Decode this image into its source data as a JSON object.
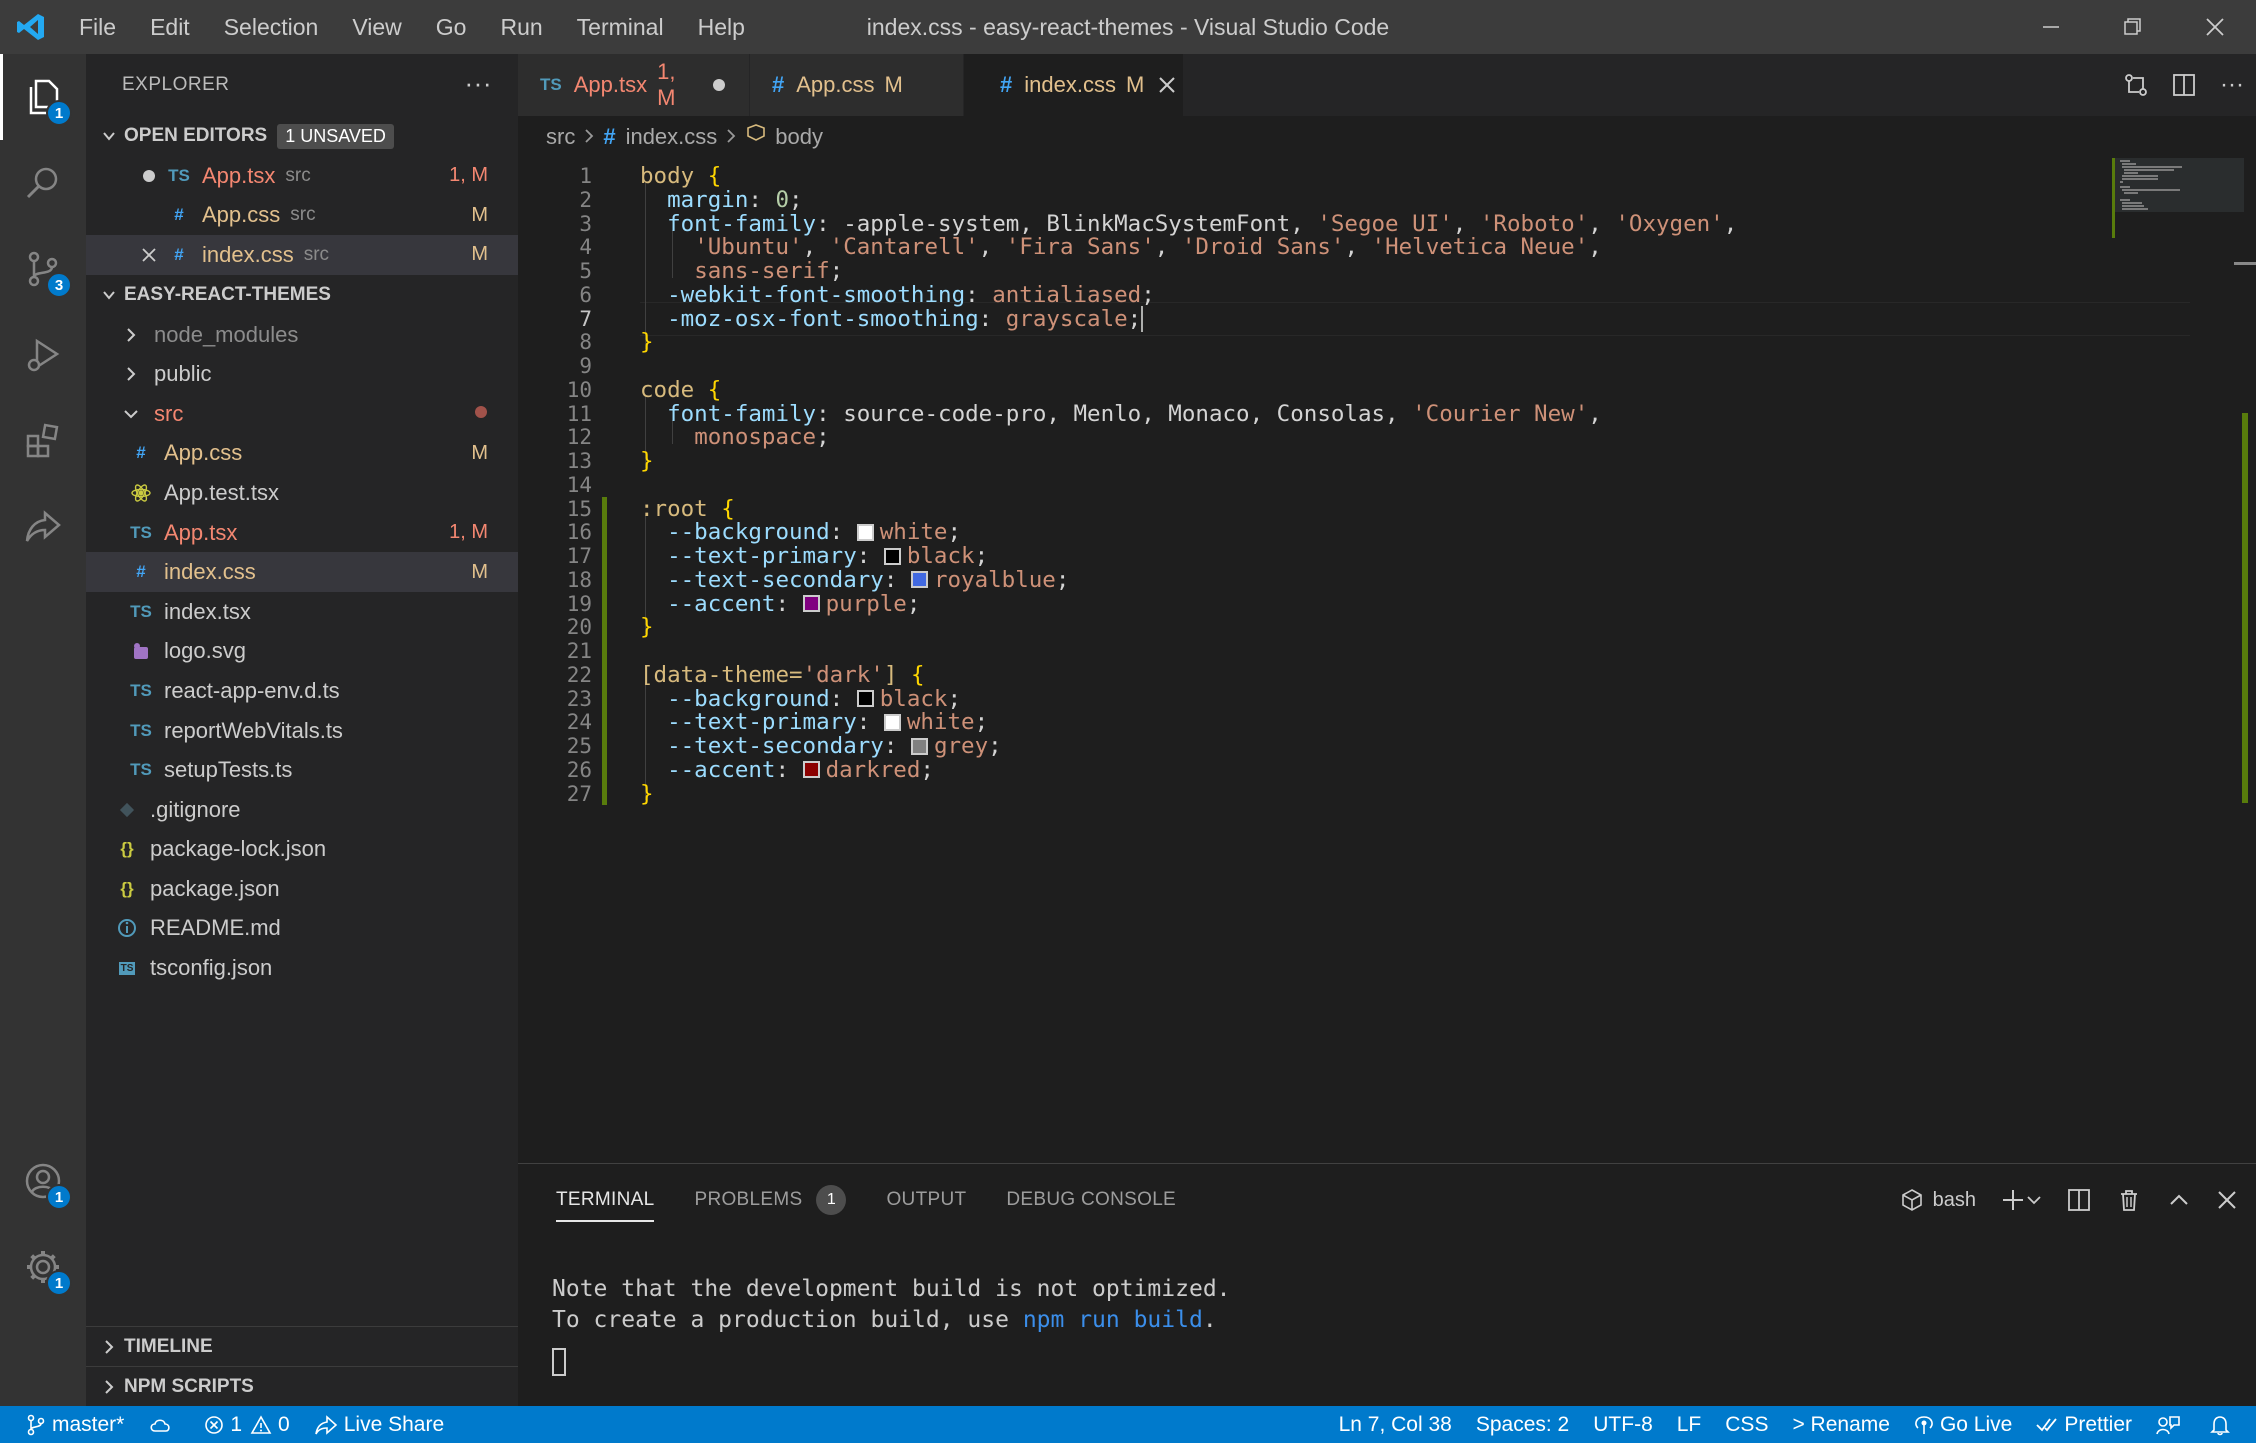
{
  "window": {
    "title": "index.css - easy-react-themes - Visual Studio Code",
    "menu": [
      "File",
      "Edit",
      "Selection",
      "View",
      "Go",
      "Run",
      "Terminal",
      "Help"
    ]
  },
  "activity_bar": {
    "explorer_badge": "1",
    "source_control_badge": "3",
    "accounts_badge": "1",
    "settings_badge": "1"
  },
  "sidebar": {
    "title": "EXPLORER",
    "open_editors": {
      "label": "OPEN EDITORS",
      "badge": "1 UNSAVED",
      "items": [
        {
          "icon": "TS",
          "name": "App.tsx",
          "desc": "src",
          "status": "1, M"
        },
        {
          "icon": "#",
          "name": "App.css",
          "desc": "src",
          "status": "M"
        },
        {
          "icon": "#",
          "name": "index.css",
          "desc": "src",
          "status": "M"
        }
      ]
    },
    "project": {
      "label": "EASY-REACT-THEMES",
      "items": [
        {
          "name": "node_modules",
          "status": ""
        },
        {
          "name": "public",
          "status": ""
        },
        {
          "name": "src",
          "status": ""
        },
        {
          "icon": "#",
          "name": "App.css",
          "status": "M"
        },
        {
          "name": "App.test.tsx",
          "status": ""
        },
        {
          "icon": "TS",
          "name": "App.tsx",
          "status": "1, M"
        },
        {
          "icon": "#",
          "name": "index.css",
          "status": "M"
        },
        {
          "icon": "TS",
          "name": "index.tsx",
          "status": ""
        },
        {
          "name": "logo.svg",
          "status": ""
        },
        {
          "icon": "TS",
          "name": "react-app-env.d.ts",
          "status": ""
        },
        {
          "icon": "TS",
          "name": "reportWebVitals.ts",
          "status": ""
        },
        {
          "icon": "TS",
          "name": "setupTests.ts",
          "status": ""
        },
        {
          "name": ".gitignore",
          "status": ""
        },
        {
          "icon": "{}",
          "name": "package-lock.json",
          "status": ""
        },
        {
          "icon": "{}",
          "name": "package.json",
          "status": ""
        },
        {
          "name": "README.md",
          "status": ""
        },
        {
          "icon": "TS",
          "name": "tsconfig.json",
          "status": ""
        }
      ]
    },
    "timeline_label": "TIMELINE",
    "npm_scripts_label": "NPM SCRIPTS"
  },
  "tabs": [
    {
      "icon": "TS",
      "name": "App.tsx",
      "status": "1, M"
    },
    {
      "icon": "#",
      "name": "App.css",
      "status": "M"
    },
    {
      "icon": "#",
      "name": "index.css",
      "status": "M"
    }
  ],
  "breadcrumbs": {
    "folder": "src",
    "icon": "#",
    "file": "index.css",
    "symbol": "body"
  },
  "code_lines": [
    [
      [
        "t-sel",
        "body"
      ],
      [
        "t-plain",
        " "
      ],
      [
        "t-brace",
        "{"
      ]
    ],
    [
      [
        "t-plain",
        "  "
      ],
      [
        "t-prop",
        "margin"
      ],
      [
        "t-plain",
        ": "
      ],
      [
        "t-num",
        "0"
      ],
      [
        "t-plain",
        ";"
      ]
    ],
    [
      [
        "t-plain",
        "  "
      ],
      [
        "t-prop",
        "font-family"
      ],
      [
        "t-plain",
        ": -apple-system, BlinkMacSystemFont, "
      ],
      [
        "t-str",
        "'Segoe UI'"
      ],
      [
        "t-plain",
        ", "
      ],
      [
        "t-str",
        "'Roboto'"
      ],
      [
        "t-plain",
        ", "
      ],
      [
        "t-str",
        "'Oxygen'"
      ],
      [
        "t-plain",
        ","
      ]
    ],
    [
      [
        "t-plain",
        "    "
      ],
      [
        "t-str",
        "'Ubuntu'"
      ],
      [
        "t-plain",
        ", "
      ],
      [
        "t-str",
        "'Cantarell'"
      ],
      [
        "t-plain",
        ", "
      ],
      [
        "t-str",
        "'Fira Sans'"
      ],
      [
        "t-plain",
        ", "
      ],
      [
        "t-str",
        "'Droid Sans'"
      ],
      [
        "t-plain",
        ", "
      ],
      [
        "t-str",
        "'Helvetica Neue'"
      ],
      [
        "t-plain",
        ","
      ]
    ],
    [
      [
        "t-plain",
        "    "
      ],
      [
        "t-val",
        "sans-serif"
      ],
      [
        "t-plain",
        ";"
      ]
    ],
    [
      [
        "t-plain",
        "  "
      ],
      [
        "t-prop",
        "-webkit-font-smoothing"
      ],
      [
        "t-plain",
        ": "
      ],
      [
        "t-val",
        "antialiased"
      ],
      [
        "t-plain",
        ";"
      ]
    ],
    [
      [
        "t-plain",
        "  "
      ],
      [
        "t-prop",
        "-moz-osx-font-smoothing"
      ],
      [
        "t-plain",
        ": "
      ],
      [
        "t-val",
        "grayscale"
      ],
      [
        "t-plain",
        ";"
      ],
      [
        "cursor",
        ""
      ]
    ],
    [
      [
        "t-brace",
        "}"
      ]
    ],
    [],
    [
      [
        "t-sel",
        "code"
      ],
      [
        "t-plain",
        " "
      ],
      [
        "t-brace",
        "{"
      ]
    ],
    [
      [
        "t-plain",
        "  "
      ],
      [
        "t-prop",
        "font-family"
      ],
      [
        "t-plain",
        ": source-code-pro, Menlo, Monaco, Consolas, "
      ],
      [
        "t-str",
        "'Courier New'"
      ],
      [
        "t-plain",
        ","
      ]
    ],
    [
      [
        "t-plain",
        "    "
      ],
      [
        "t-val",
        "monospace"
      ],
      [
        "t-plain",
        ";"
      ]
    ],
    [
      [
        "t-brace",
        "}"
      ]
    ],
    [],
    [
      [
        "t-sel",
        ":root"
      ],
      [
        "t-plain",
        " "
      ],
      [
        "t-brace",
        "{"
      ]
    ],
    [
      [
        "t-plain",
        "  "
      ],
      [
        "t-prop",
        "--background"
      ],
      [
        "t-plain",
        ": "
      ],
      [
        "swatch",
        "#ffffff"
      ],
      [
        "t-val",
        "white"
      ],
      [
        "t-plain",
        ";"
      ]
    ],
    [
      [
        "t-plain",
        "  "
      ],
      [
        "t-prop",
        "--text-primary"
      ],
      [
        "t-plain",
        ": "
      ],
      [
        "swatch",
        "#000000"
      ],
      [
        "t-val",
        "black"
      ],
      [
        "t-plain",
        ";"
      ]
    ],
    [
      [
        "t-plain",
        "  "
      ],
      [
        "t-prop",
        "--text-secondary"
      ],
      [
        "t-plain",
        ": "
      ],
      [
        "swatch",
        "#4169e1"
      ],
      [
        "t-val",
        "royalblue"
      ],
      [
        "t-plain",
        ";"
      ]
    ],
    [
      [
        "t-plain",
        "  "
      ],
      [
        "t-prop",
        "--accent"
      ],
      [
        "t-plain",
        ": "
      ],
      [
        "swatch",
        "#800080"
      ],
      [
        "t-val",
        "purple"
      ],
      [
        "t-plain",
        ";"
      ]
    ],
    [
      [
        "t-brace",
        "}"
      ]
    ],
    [],
    [
      [
        "t-sel",
        "[data-theme="
      ],
      [
        "t-str",
        "'dark'"
      ],
      [
        "t-sel",
        "]"
      ],
      [
        "t-plain",
        " "
      ],
      [
        "t-brace",
        "{"
      ]
    ],
    [
      [
        "t-plain",
        "  "
      ],
      [
        "t-prop",
        "--background"
      ],
      [
        "t-plain",
        ": "
      ],
      [
        "swatch",
        "#000000"
      ],
      [
        "t-val",
        "black"
      ],
      [
        "t-plain",
        ";"
      ]
    ],
    [
      [
        "t-plain",
        "  "
      ],
      [
        "t-prop",
        "--text-primary"
      ],
      [
        "t-plain",
        ": "
      ],
      [
        "swatch",
        "#ffffff"
      ],
      [
        "t-val",
        "white"
      ],
      [
        "t-plain",
        ";"
      ]
    ],
    [
      [
        "t-plain",
        "  "
      ],
      [
        "t-prop",
        "--text-secondary"
      ],
      [
        "t-plain",
        ": "
      ],
      [
        "swatch",
        "#808080"
      ],
      [
        "t-val",
        "grey"
      ],
      [
        "t-plain",
        ";"
      ]
    ],
    [
      [
        "t-plain",
        "  "
      ],
      [
        "t-prop",
        "--accent"
      ],
      [
        "t-plain",
        ": "
      ],
      [
        "swatch",
        "#8b0000"
      ],
      [
        "t-val",
        "darkred"
      ],
      [
        "t-plain",
        ";"
      ]
    ],
    [
      [
        "t-brace",
        "}"
      ]
    ]
  ],
  "current_line": 7,
  "panel": {
    "tabs": [
      "TERMINAL",
      "PROBLEMS",
      "OUTPUT",
      "DEBUG CONSOLE"
    ],
    "problems_count": "1",
    "shell": "bash",
    "terminal_line1": "Note that the development build is not optimized.",
    "terminal_line2_prefix": "To create a production build, use ",
    "terminal_line2_link": "npm run build",
    "terminal_line2_suffix": "."
  },
  "status_bar": {
    "branch": "master*",
    "errors": "1",
    "warnings": "0",
    "live_share": "Live Share",
    "position": "Ln 7, Col 38",
    "spaces": "Spaces: 2",
    "encoding": "UTF-8",
    "eol": "LF",
    "language": "CSS",
    "rename": "> Rename",
    "go_live": "Go Live",
    "prettier": "Prettier"
  },
  "colors": {
    "accent": "#007acc",
    "modified": "#e2c08d",
    "error": "#f48771"
  }
}
